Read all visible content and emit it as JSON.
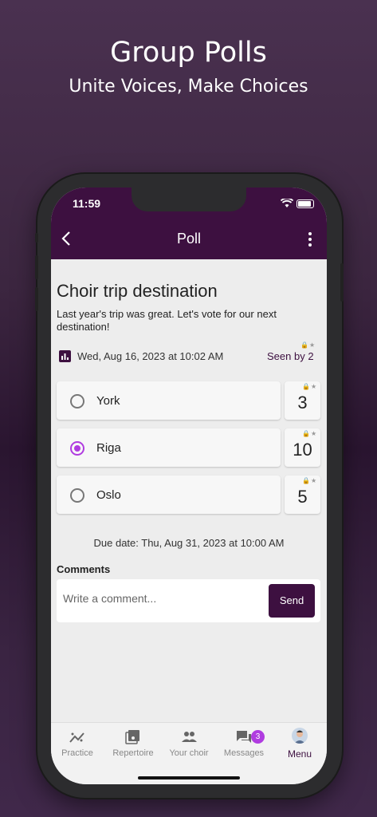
{
  "hero": {
    "title": "Group Polls",
    "subtitle": "Unite Voices, Make Choices"
  },
  "status": {
    "time": "11:59"
  },
  "nav": {
    "title": "Poll"
  },
  "poll": {
    "title": "Choir trip destination",
    "description": "Last year's trip was great. Let's vote for our next destination!",
    "date": "Wed, Aug 16, 2023 at 10:02 AM",
    "seen": "Seen by 2",
    "options": [
      {
        "label": "York",
        "count": "3",
        "selected": false
      },
      {
        "label": "Riga",
        "count": "10",
        "selected": true
      },
      {
        "label": "Oslo",
        "count": "5",
        "selected": false
      }
    ],
    "due": "Due date: Thu, Aug 31, 2023 at 10:00 AM"
  },
  "comments": {
    "label": "Comments",
    "placeholder": "Write a comment...",
    "send": "Send"
  },
  "tabs": [
    {
      "label": "Practice",
      "icon": "practice-icon"
    },
    {
      "label": "Repertoire",
      "icon": "repertoire-icon"
    },
    {
      "label": "Your choir",
      "icon": "people-icon"
    },
    {
      "label": "Messages",
      "icon": "messages-icon",
      "badge": "3"
    },
    {
      "label": "Menu",
      "icon": "avatar-icon",
      "active": true
    }
  ],
  "colors": {
    "brand": "#3d1040",
    "accent": "#b03ce0"
  }
}
